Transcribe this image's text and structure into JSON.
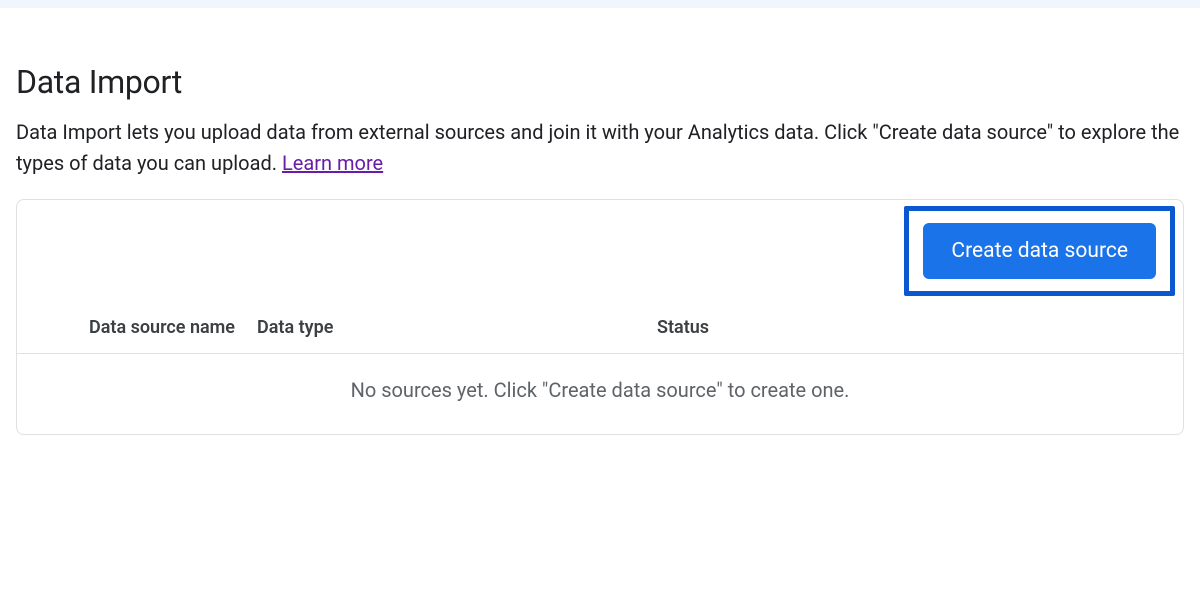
{
  "header": {
    "title": "Data Import",
    "description_part1": "Data Import lets you upload data from external sources and join it with your Analytics data. Click \"Create data source\" to explore the types of data you can upload. ",
    "learn_more_label": "Learn more"
  },
  "card": {
    "create_button_label": "Create data source",
    "columns": {
      "name": "Data source name",
      "type": "Data type",
      "status": "Status"
    },
    "empty_message": "No sources yet. Click \"Create data source\" to create one."
  }
}
